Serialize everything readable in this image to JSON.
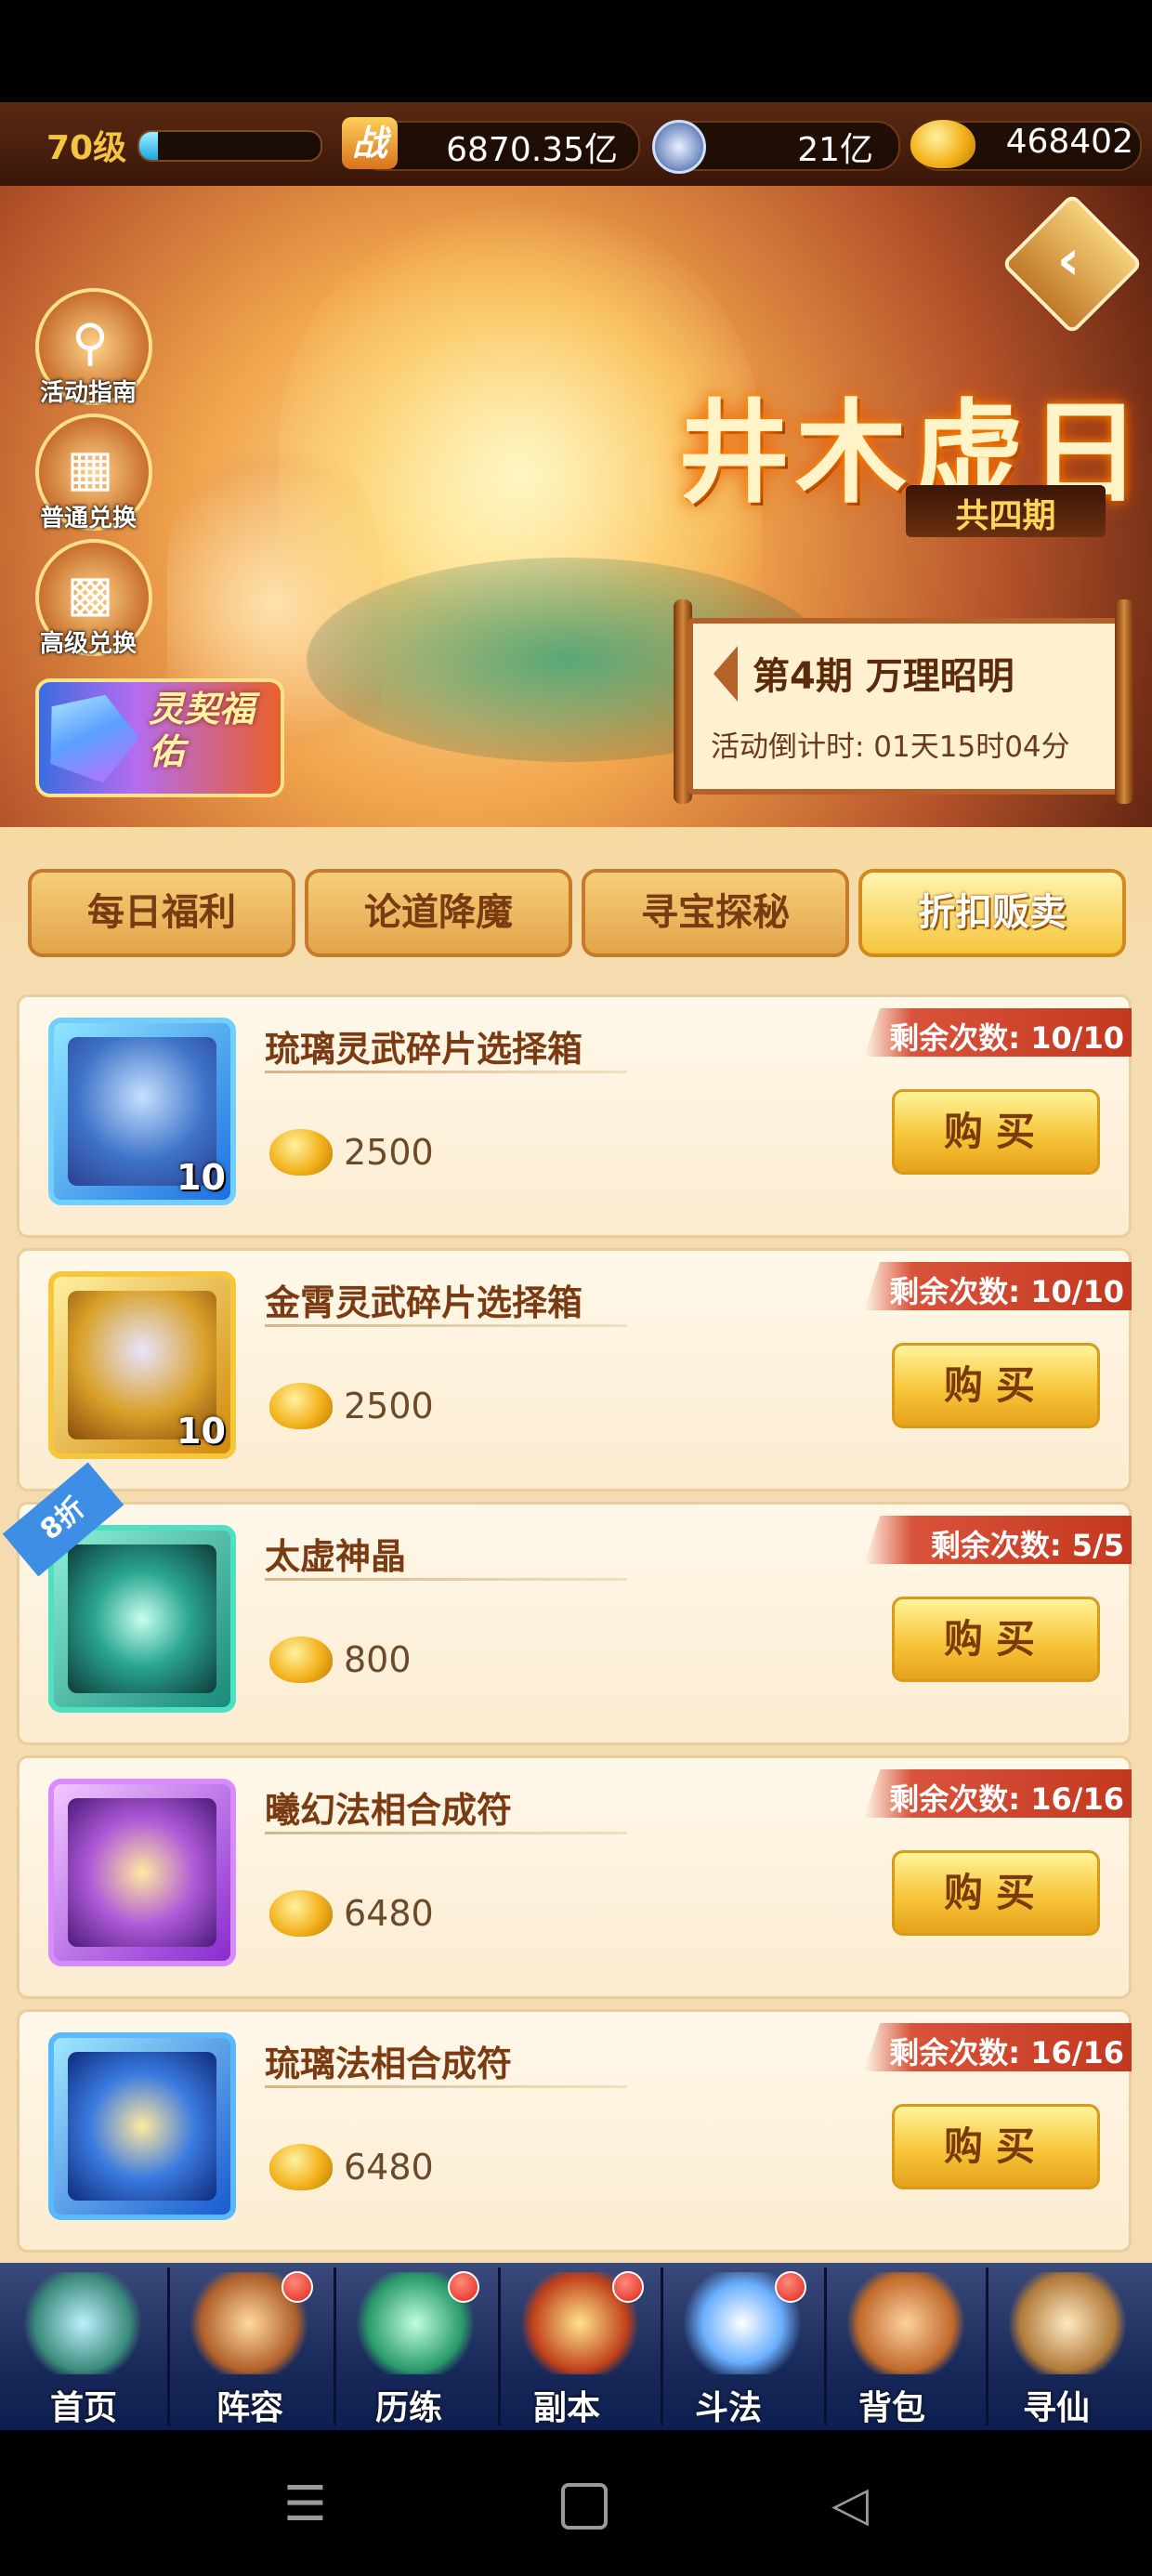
{
  "top": {
    "level": "70级",
    "xp_fraction": 0.1,
    "power": "6870.35亿",
    "silver": "21亿",
    "gold": "468402"
  },
  "banner": {
    "title": "井木虚日",
    "subtitle": "共四期",
    "period": "第4期  万理昭明",
    "countdown": "活动倒计时: 01天15时04分",
    "pact": "灵契福佑",
    "side_buttons": [
      "活动指南",
      "普通兑换",
      "高级兑换"
    ]
  },
  "tabs": [
    "每日福利",
    "论道降魔",
    "寻宝探秘",
    "折扣贩卖"
  ],
  "items": [
    {
      "name": "琉璃灵武碎片选择箱",
      "price": "2500",
      "remaining": "剩余次数: 10/10",
      "count": "10",
      "buy": "购买"
    },
    {
      "name": "金霄灵武碎片选择箱",
      "price": "2500",
      "remaining": "剩余次数: 10/10",
      "count": "10",
      "buy": "购买"
    },
    {
      "name": "太虚神晶",
      "price": "800",
      "remaining": "剩余次数: 5/5",
      "count": "",
      "buy": "购买",
      "discount": "8折"
    },
    {
      "name": "曦幻法相合成符",
      "price": "6480",
      "remaining": "剩余次数: 16/16",
      "count": "",
      "buy": "购买"
    },
    {
      "name": "琉璃法相合成符",
      "price": "6480",
      "remaining": "剩余次数: 16/16",
      "count": "",
      "buy": "购买"
    }
  ],
  "nav": [
    "首页",
    "阵容",
    "历练",
    "副本",
    "斗法",
    "背包",
    "寻仙"
  ],
  "colors": {
    "accent_gold": "#f7c63a",
    "remain_red": "#c2381f",
    "nav_blue": "#1a2a5a"
  }
}
